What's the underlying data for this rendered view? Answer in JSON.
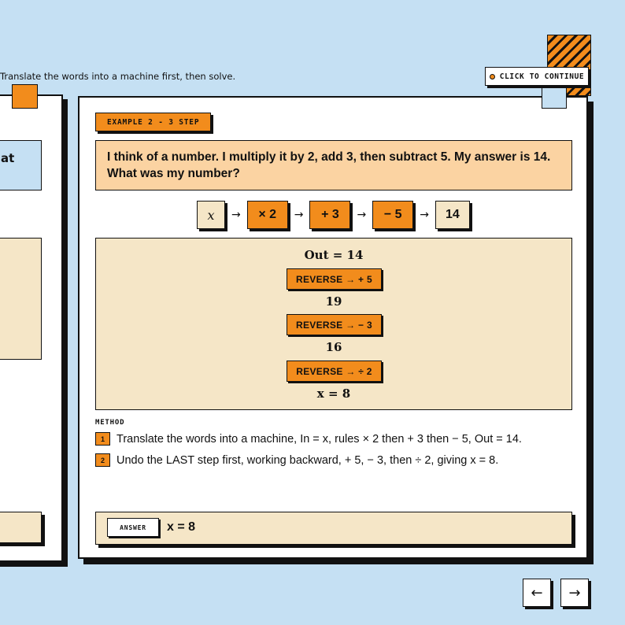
{
  "header": {
    "instruction": "Translate the words into a machine first, then solve.",
    "continue_label": "CLICK TO CONTINUE"
  },
  "left_card": {
    "partial_text": "at"
  },
  "example": {
    "label": "EXAMPLE 2 - 3 STEP",
    "problem": "I think of a number. I multiply it by 2, add 3, then subtract 5. My answer is 14. What was my number?"
  },
  "machine": {
    "input": "x",
    "rules": [
      "× 2",
      "+ 3",
      "− 5"
    ],
    "output": "14",
    "arrow": "→"
  },
  "reverse_steps": {
    "start": "Out = 14",
    "buttons": [
      "REVERSE → + 5",
      "REVERSE → − 3",
      "REVERSE → ÷ 2"
    ],
    "results": [
      "19",
      "16",
      "x = 8"
    ]
  },
  "method": {
    "heading": "METHOD",
    "items": [
      {
        "num": "1",
        "text": "Translate the words into a machine, In = x, rules × 2 then + 3 then − 5, Out = 14."
      },
      {
        "num": "2",
        "text": "Undo the LAST step first, working backward, + 5, − 3, then ÷ 2, giving x = 8."
      }
    ]
  },
  "answer": {
    "label": "ANSWER",
    "value": "x = 8"
  },
  "navigation": {
    "prev": "←",
    "next": "→"
  },
  "colors": {
    "background": "#c5e0f3",
    "accent_orange": "#f28c1c",
    "beige": "#f5e6c7",
    "peach": "#fbd3a2",
    "ink": "#111111"
  }
}
